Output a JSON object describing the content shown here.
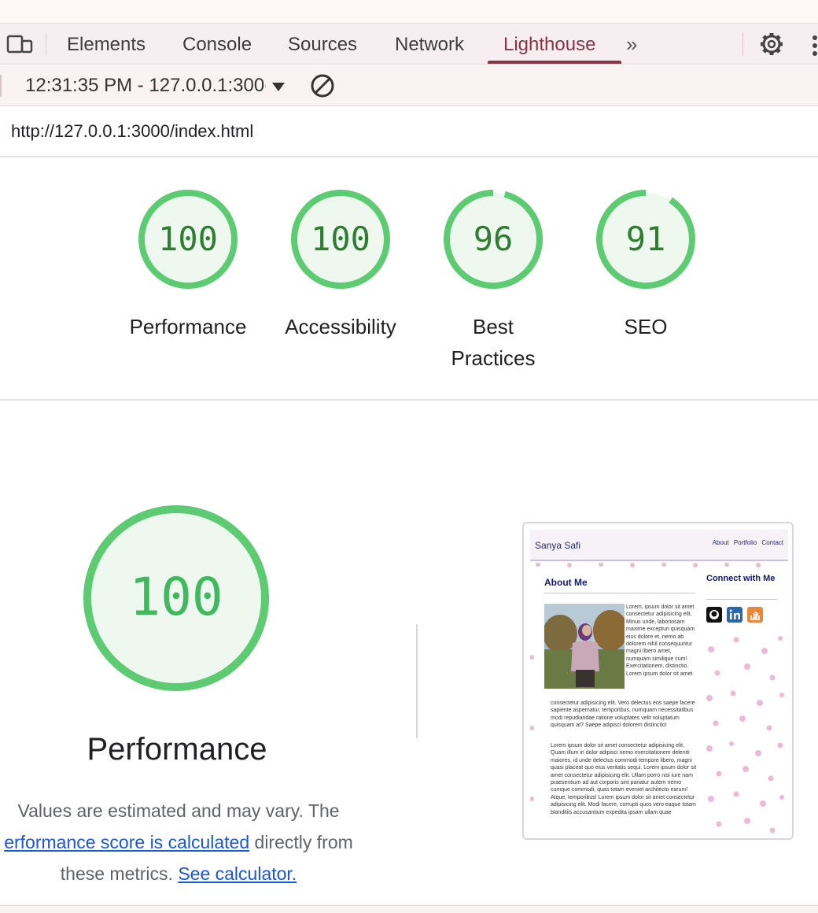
{
  "devtools": {
    "tabs": [
      {
        "label": "Elements"
      },
      {
        "label": "Console"
      },
      {
        "label": "Sources"
      },
      {
        "label": "Network"
      },
      {
        "label": "Lighthouse"
      }
    ],
    "active_tab": "Lighthouse",
    "more_tabs_glyph": "»"
  },
  "toolbar": {
    "report_selector": "12:31:35 PM - 127.0.0.1:300("
  },
  "url": "http://127.0.0.1:3000/index.html",
  "gauges": [
    {
      "score": "100",
      "label": "Performance",
      "value": 100
    },
    {
      "score": "100",
      "label": "Accessibility",
      "value": 100
    },
    {
      "score": "96",
      "label": "Best Practices",
      "value": 96
    },
    {
      "score": "91",
      "label": "SEO",
      "value": 91
    }
  ],
  "performance": {
    "score": "100",
    "title": "Performance",
    "desc_before": "Values are estimated and may vary. The ",
    "desc_link": "erformance score is calculated",
    "desc_middle": " directly from these metrics. ",
    "calc_link": "See calculator."
  },
  "screenshot": {
    "brand": "Sanya Safi",
    "nav_links": [
      "About",
      "Portfolio",
      "Contact"
    ],
    "about_heading": "About Me",
    "connect_heading": "Connect with Me",
    "para1_beside": "Lorem, ipsum dolor sit amet consectetur adipisicing elit. Minus unde, laboriosam maxime excepturi quisquam eius dolore et, nemo ab dolorem nihil consequuntur magni libero amet, numquam similique cum! Exercitationem, distinctio. Lorem ipsum dolor sit amet",
    "para1_below": "consectetur adipisicing elit. Vero delectus eos saepe facere sapiente aspernatur, temporibus, numquam necessitatibus modi repudiandae ratione voluptates velit voluptatum quisquam at? Saepe adipisci dolorem distinctio!",
    "para2": "Lorem ipsum dolor sit amet consectetur adipisicing elit. Quam illum in dolor adipisci nemo exercitationem deleniti maiores, id unde delectus commodi tempore libero, magni quasi placeat quo eius veritatis sequi. Lorem ipsum dolor sit amet consectetur adipisicing elit. Ullam porro nisi iure nam praesentium ad aut corporis sint pariatur autem nemo cumque commodi, quas totam eveniet architecto earum! Atque, temporibus! Lorem ipsum dolor sit amet consectetur adipisicing elit. Modi facere, corrupti quos vero eaque totam blanditiis accusantium expedita ipsam ullam quae",
    "social_icons": [
      "github-icon",
      "linkedin-icon",
      "stackoverflow-icon"
    ]
  },
  "colors": {
    "pass_green": "#0cce6b",
    "pass_stroke": "#5ccb72",
    "gauge_fill": "#eef8ef",
    "score_text": "#2e7d32",
    "active_tab": "#8a3446",
    "link": "#1a56db"
  }
}
